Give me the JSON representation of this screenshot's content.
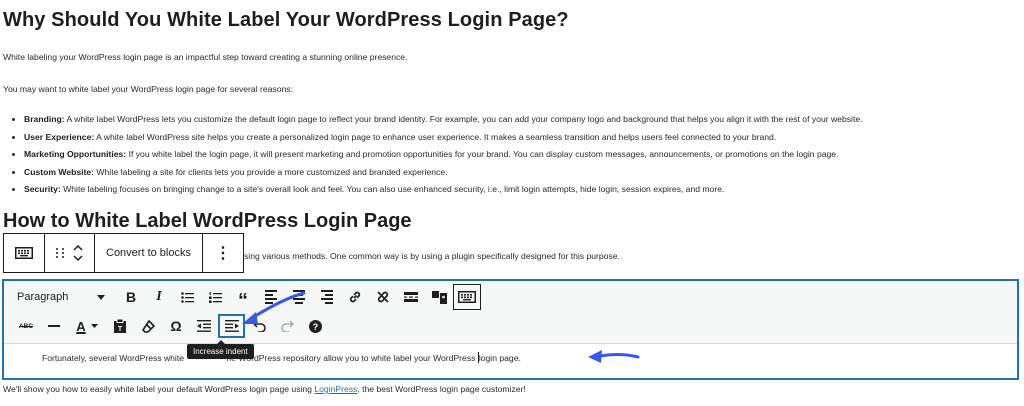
{
  "article": {
    "heading1": "Why Should You White Label Your WordPress Login Page?",
    "intro": "White labeling your WordPress login page is an impactful step toward creating a stunning online presence.",
    "reasons_intro": "You may want to white label your WordPress login page for several reasons:",
    "bullets": [
      {
        "title": "Branding:",
        "text": " A white label WordPress lets you customize the default login page to reflect your brand identity. For example, you can add your company logo and background that helps you align it with the rest of your website."
      },
      {
        "title": "User Experience:",
        "text": " A white label WordPress site helps you create a personalized login page to enhance user experience. It makes a seamless transition and helps users feel connected to your brand."
      },
      {
        "title": "Marketing Opportunities:",
        "text": " If you white label the login page, it will present marketing and promotion opportunities for your brand. You can display custom messages, announcements, or promotions on the login page."
      },
      {
        "title": "Custom Website:",
        "text": " White labeling a site for clients lets you provide a more customized and branded experience."
      },
      {
        "title": "Security:",
        "text": " White labeling focuses on bringing change to a site's overall look and feel. You can also use enhanced security, i.e., limit login attempts, hide login, session expires, and more."
      }
    ],
    "heading2": "How to White Label WordPress Login Page",
    "partial_text": "sing various methods. One common way is by using a plugin specifically designed for this purpose.",
    "after_text_pre": "We'll show you how to easily white label your default WordPress login page using ",
    "after_link": "LoginPress",
    "after_text_post": ", the best WordPress login page customizer!"
  },
  "block_toolbar": {
    "convert_label": "Convert to blocks",
    "more_label": "⋮"
  },
  "editor": {
    "format_select": "Paragraph",
    "content_left": "Fortunately, several WordPress white ",
    "content_mid": "he WordPress repository allow you to white label your WordPress ",
    "content_right": "login page."
  },
  "tooltip": "Increase indent",
  "colors": {
    "accent": "#2271b1",
    "text": "#1e1e1e",
    "arrow": "#3858e9"
  }
}
